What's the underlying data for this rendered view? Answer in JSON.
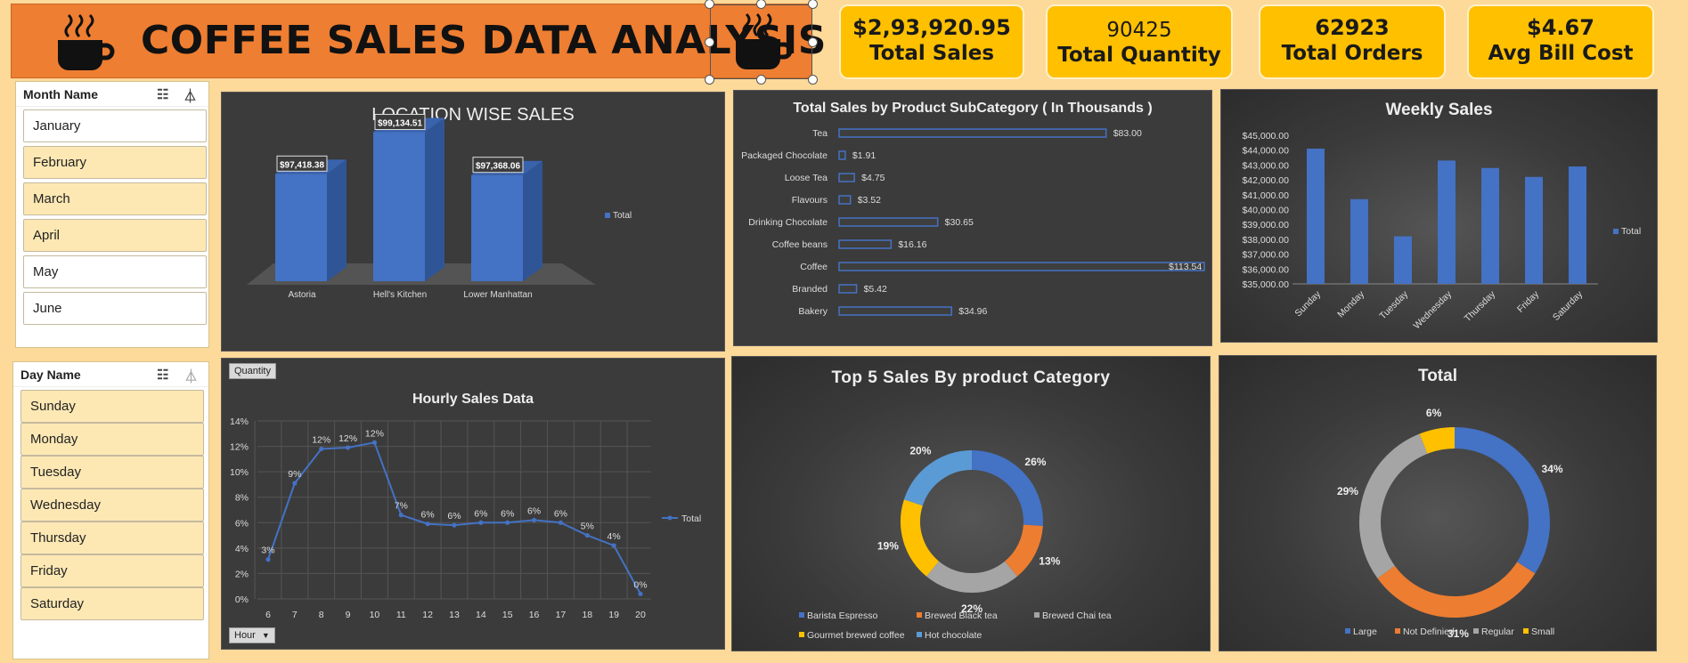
{
  "header": {
    "title": "COFFEE SALES DATA ANALYSIS"
  },
  "kpis": [
    {
      "value": "$2,93,920.95",
      "label": "Total Sales"
    },
    {
      "value": "90425",
      "label": "Total Quantity"
    },
    {
      "value": "62923",
      "label": "Total Orders"
    },
    {
      "value": "$4.67",
      "label": "Avg Bill Cost"
    }
  ],
  "month_slicer": {
    "title": "Month Name",
    "items": [
      {
        "label": "January",
        "selected": false
      },
      {
        "label": "February",
        "selected": true
      },
      {
        "label": "March",
        "selected": true
      },
      {
        "label": "April",
        "selected": true
      },
      {
        "label": "May",
        "selected": false
      },
      {
        "label": "June",
        "selected": false
      }
    ]
  },
  "day_slicer": {
    "title": "Day Name",
    "items": [
      {
        "label": "Sunday",
        "selected": true
      },
      {
        "label": "Monday",
        "selected": true
      },
      {
        "label": "Tuesday",
        "selected": true
      },
      {
        "label": "Wednesday",
        "selected": true
      },
      {
        "label": "Thursday",
        "selected": true
      },
      {
        "label": "Friday",
        "selected": true
      },
      {
        "label": "Saturday",
        "selected": true
      }
    ]
  },
  "colors": {
    "blue": "#4472c4",
    "orange": "#ed7d31",
    "gray": "#a5a5a5",
    "yellow": "#ffc000",
    "lightblue": "#5b9bd5",
    "banner": "#ee7e32"
  },
  "icons": [
    "coffee-cup-icon",
    "multi-select-icon",
    "clear-filter-icon",
    "dropdown-arrow-icon"
  ],
  "chart_data": [
    {
      "id": "location",
      "type": "bar",
      "title": "LOCATION WISE SALES",
      "categories": [
        "Astoria",
        "Hell's Kitchen",
        "Lower Manhattan"
      ],
      "series": [
        {
          "name": "Total",
          "values": [
            97418.38,
            99134.51,
            97368.06
          ]
        }
      ],
      "data_labels": [
        "$97,418.38",
        "$99,134.51",
        "$97,368.06"
      ],
      "legend": "right"
    },
    {
      "id": "subcategory",
      "type": "bar",
      "orientation": "horizontal",
      "title": "Total Sales by Product SubCategory ( In Thousands )",
      "categories": [
        "Tea",
        "Packaged Chocolate",
        "Loose Tea",
        "Flavours",
        "Drinking Chocolate",
        "Coffee beans",
        "Coffee",
        "Branded",
        "Bakery"
      ],
      "values": [
        83.0,
        1.91,
        4.75,
        3.52,
        30.65,
        16.16,
        113.54,
        5.42,
        34.96
      ],
      "data_labels": [
        "$83.00",
        "$1.91",
        "$4.75",
        "$3.52",
        "$30.65",
        "$16.16",
        "$113.54",
        "$5.42",
        "$34.96"
      ]
    },
    {
      "id": "weekly",
      "type": "bar",
      "title": "Weekly Sales",
      "categories": [
        "Sunday",
        "Monday",
        "Tuesday",
        "Wednesday",
        "Thursday",
        "Friday",
        "Saturday"
      ],
      "series": [
        {
          "name": "Total",
          "values": [
            44100,
            40700,
            38200,
            43300,
            42800,
            42200,
            42900
          ]
        }
      ],
      "ylim": [
        35000,
        45000
      ],
      "yticks": [
        "$35,000.00",
        "$36,000.00",
        "$37,000.00",
        "$38,000.00",
        "$39,000.00",
        "$40,000.00",
        "$41,000.00",
        "$42,000.00",
        "$43,000.00",
        "$44,000.00",
        "$45,000.00"
      ],
      "legend": "right"
    },
    {
      "id": "hourly",
      "type": "line",
      "title": "Hourly Sales Data",
      "x": [
        6,
        7,
        8,
        9,
        10,
        11,
        12,
        13,
        14,
        15,
        16,
        17,
        18,
        19,
        20
      ],
      "series": [
        {
          "name": "Total",
          "values": [
            3.1,
            9.1,
            11.8,
            11.9,
            12.3,
            6.6,
            5.9,
            5.8,
            6.0,
            6.0,
            6.2,
            6.0,
            5.0,
            4.2,
            0.4
          ]
        }
      ],
      "data_labels": [
        "3%",
        "9%",
        "12%",
        "12%",
        "12%",
        "7%",
        "6%",
        "6%",
        "6%",
        "6%",
        "6%",
        "6%",
        "5%",
        "4%",
        "0%"
      ],
      "ylim": [
        0,
        14
      ],
      "yticks": [
        "0%",
        "2%",
        "4%",
        "6%",
        "8%",
        "10%",
        "12%",
        "14%"
      ],
      "grid": true,
      "legend": "right",
      "field_buttons": {
        "value": "Quantity",
        "axis": "Hour"
      }
    },
    {
      "id": "top5",
      "type": "pie",
      "donut": true,
      "title": "Top 5 Sales By product Category",
      "categories": [
        "Barista Espresso",
        "Brewed Black tea",
        "Brewed Chai tea",
        "Gourmet brewed coffee",
        "Hot chocolate"
      ],
      "values": [
        26,
        13,
        22,
        19,
        20
      ],
      "data_labels": [
        "26%",
        "13%",
        "22%",
        "19%",
        "20%"
      ],
      "legend": "bottom"
    },
    {
      "id": "size",
      "type": "pie",
      "donut": true,
      "title": "Total",
      "categories": [
        "Large",
        "Not Definied",
        "Regular",
        "Small"
      ],
      "values": [
        34,
        31,
        29,
        6
      ],
      "data_labels": [
        "34%",
        "31%",
        "29%",
        "6%"
      ],
      "legend": "bottom"
    }
  ]
}
